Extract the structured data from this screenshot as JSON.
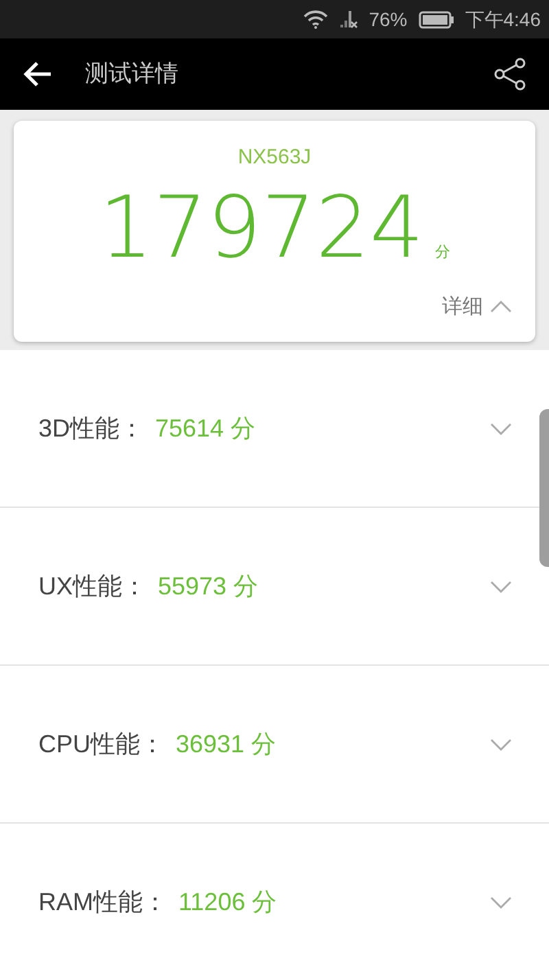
{
  "status_bar": {
    "battery": "76%",
    "time": "下午4:46"
  },
  "app_bar": {
    "title": "测试详情"
  },
  "summary": {
    "device": "NX563J",
    "score": "179724",
    "unit": "分",
    "details_label": "详细",
    "expanded": true
  },
  "rows": [
    {
      "label": "3D性能：",
      "score": "75614 分",
      "expanded": false
    },
    {
      "label": "UX性能：",
      "score": "55973 分",
      "expanded": false
    },
    {
      "label": "CPU性能：",
      "score": "36931 分",
      "expanded": false
    },
    {
      "label": "RAM性能：",
      "score": "11206 分",
      "expanded": false
    }
  ]
}
